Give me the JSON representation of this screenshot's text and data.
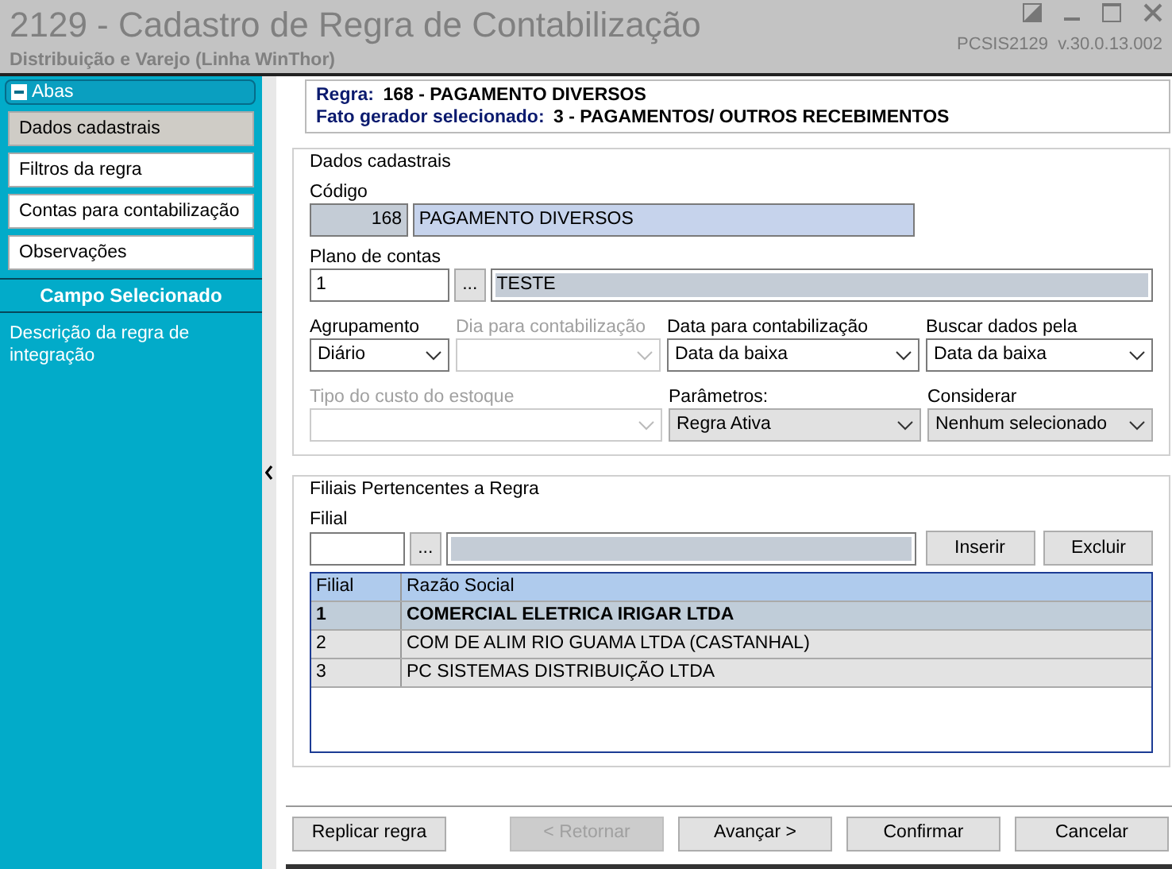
{
  "window": {
    "title": "2129 - Cadastro de Regra de Contabilização",
    "subtitle": "Distribuição e Varejo (Linha WinThor)",
    "version": "PCSIS2129  v.30.0.13.002"
  },
  "sidebar": {
    "group_label": "Abas",
    "expanded": true,
    "items": [
      {
        "label": "Dados cadastrais",
        "selected": true
      },
      {
        "label": "Filtros da regra",
        "selected": false
      },
      {
        "label": "Contas para contabilização",
        "selected": false
      },
      {
        "label": "Observações",
        "selected": false
      }
    ],
    "section_title": "Campo Selecionado",
    "description": "Descrição da regra de integração"
  },
  "header": {
    "rule_label": "Regra:",
    "rule_value": "168 - PAGAMENTO DIVERSOS",
    "event_label": "Fato gerador selecionado:",
    "event_value": "3 - PAGAMENTOS/ OUTROS RECEBIMENTOS"
  },
  "dados": {
    "legend": "Dados cadastrais",
    "codigo_label": "Código",
    "codigo": "168",
    "descricao": "PAGAMENTO DIVERSOS",
    "plano_label": "Plano de contas",
    "plano": "1",
    "lookup": "...",
    "plano_desc": "TESTE",
    "selects": [
      [
        {
          "label": "Agrupamento",
          "value": "Diário",
          "disabled": false,
          "kind": "combo"
        },
        {
          "label": "Dia para contabilização",
          "disabled": true,
          "kind": "combo"
        },
        {
          "label": "Data para contabilização",
          "value": "Data da baixa",
          "disabled": false,
          "kind": "combo"
        },
        {
          "label": "Buscar dados pela",
          "value": "Data da baixa",
          "disabled": false,
          "kind": "combo"
        }
      ],
      [
        {
          "label": "Tipo do custo do estoque",
          "disabled": true,
          "kind": "combo"
        },
        {
          "label": "Parâmetros:",
          "value": "Regra Ativa",
          "disabled": false,
          "kind": "dropdown"
        },
        {
          "label": "Considerar",
          "value": "Nenhum selecionado",
          "disabled": false,
          "kind": "dropdown"
        }
      ]
    ]
  },
  "filiais": {
    "legend": "Filiais Pertencentes a Regra",
    "filial_label": "Filial",
    "lookup": "...",
    "buttons": [
      "Inserir",
      "Excluir"
    ],
    "table": {
      "columns": [
        "Filial",
        "Razão Social"
      ],
      "rows": [
        {
          "cells": [
            "1",
            "COMERCIAL ELETRICA IRIGAR LTDA"
          ],
          "selected": true
        },
        {
          "cells": [
            "2",
            "COM DE ALIM RIO GUAMA LTDA (CASTANHAL)"
          ],
          "selected": false
        },
        {
          "cells": [
            "3",
            "PC SISTEMAS DISTRIBUIÇÃO LTDA"
          ],
          "selected": false
        }
      ]
    }
  },
  "footer_buttons": [
    {
      "label": "Replicar regra",
      "disabled": false
    },
    {
      "label": "< Retornar",
      "disabled": true
    },
    {
      "label": "Avançar >",
      "disabled": false
    },
    {
      "label": "Confirmar",
      "disabled": false
    },
    {
      "label": "Cancelar",
      "disabled": false
    }
  ]
}
